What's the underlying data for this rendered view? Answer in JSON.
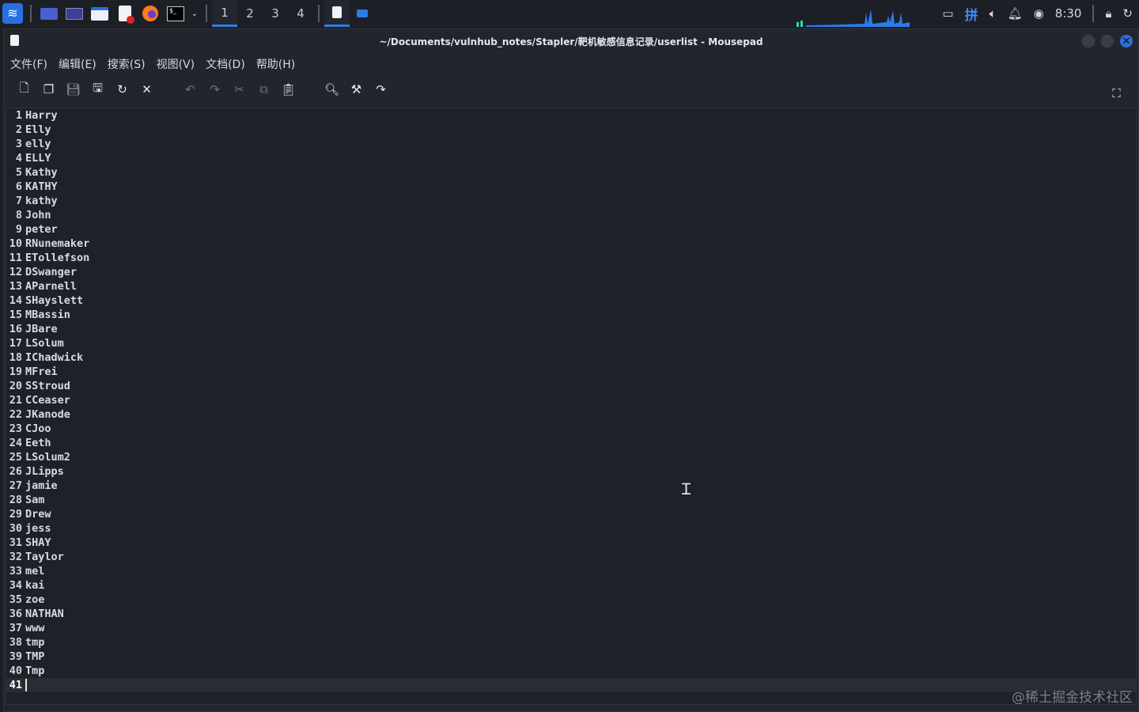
{
  "taskbar": {
    "workspaces": [
      "1",
      "2",
      "3",
      "4"
    ],
    "active_workspace": "1",
    "clock": "8:30",
    "input_method": "拼",
    "accent": "#2f7ce0"
  },
  "window": {
    "title": "~/Documents/vulnhub_notes/Stapler/靶机敏感信息记录/userlist - Mousepad",
    "close_glyph": "✕"
  },
  "menu": [
    "文件(F)",
    "编辑(E)",
    "搜索(S)",
    "视图(V)",
    "文档(D)",
    "帮助(H)"
  ],
  "editor": {
    "lines": [
      {
        "n": "1",
        "t": "Harry"
      },
      {
        "n": "2",
        "t": "Elly"
      },
      {
        "n": "3",
        "t": "elly"
      },
      {
        "n": "4",
        "t": "ELLY"
      },
      {
        "n": "5",
        "t": "Kathy"
      },
      {
        "n": "6",
        "t": "KATHY"
      },
      {
        "n": "7",
        "t": "kathy"
      },
      {
        "n": "8",
        "t": "John"
      },
      {
        "n": "9",
        "t": "peter"
      },
      {
        "n": "10",
        "t": "RNunemaker"
      },
      {
        "n": "11",
        "t": "ETollefson"
      },
      {
        "n": "12",
        "t": "DSwanger"
      },
      {
        "n": "13",
        "t": "AParnell"
      },
      {
        "n": "14",
        "t": "SHayslett"
      },
      {
        "n": "15",
        "t": "MBassin"
      },
      {
        "n": "16",
        "t": "JBare"
      },
      {
        "n": "17",
        "t": "LSolum"
      },
      {
        "n": "18",
        "t": "IChadwick"
      },
      {
        "n": "19",
        "t": "MFrei"
      },
      {
        "n": "20",
        "t": "SStroud"
      },
      {
        "n": "21",
        "t": "CCeaser"
      },
      {
        "n": "22",
        "t": "JKanode"
      },
      {
        "n": "23",
        "t": "CJoo"
      },
      {
        "n": "24",
        "t": "Eeth"
      },
      {
        "n": "25",
        "t": "LSolum2"
      },
      {
        "n": "26",
        "t": "JLipps"
      },
      {
        "n": "27",
        "t": "jamie"
      },
      {
        "n": "28",
        "t": "Sam"
      },
      {
        "n": "29",
        "t": "Drew"
      },
      {
        "n": "30",
        "t": "jess"
      },
      {
        "n": "31",
        "t": "SHAY"
      },
      {
        "n": "32",
        "t": "Taylor"
      },
      {
        "n": "33",
        "t": "mel"
      },
      {
        "n": "34",
        "t": "kai"
      },
      {
        "n": "35",
        "t": "zoe"
      },
      {
        "n": "36",
        "t": "NATHAN"
      },
      {
        "n": "37",
        "t": "www"
      },
      {
        "n": "38",
        "t": "tmp"
      },
      {
        "n": "39",
        "t": "TMP"
      },
      {
        "n": "40",
        "t": "Tmp"
      },
      {
        "n": "41",
        "t": ""
      }
    ],
    "current_line": "41"
  },
  "watermark": "@稀土掘金技术社区"
}
